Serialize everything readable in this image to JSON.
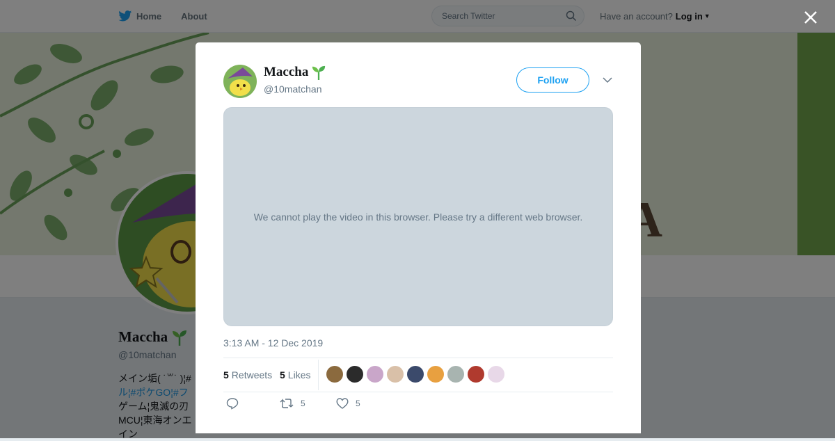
{
  "nav": {
    "home_label": "Home",
    "about_label": "About",
    "search_placeholder": "Search Twitter",
    "account_prompt": "Have an account?",
    "login_label": "Log in"
  },
  "profile": {
    "name": "Maccha",
    "handle": "@10matchan",
    "banner_letter": "A",
    "bio_lines": [
      "メイン垢( ˙꒳​˙ )¦#",
      "ル¦#ポケGO¦#フ",
      "ゲーム¦鬼滅の刃",
      "MCU¦東海オンエ",
      "イン"
    ]
  },
  "tweet": {
    "name": "Maccha",
    "handle": "@10matchan",
    "follow_label": "Follow",
    "video_message": "We cannot play the video in this browser. Please try a different web browser.",
    "timestamp": "3:13 AM - 12 Dec 2019",
    "retweets_count": "5",
    "retweets_label": "Retweets",
    "likes_count": "5",
    "likes_label": "Likes",
    "reply_count": "",
    "retweet_action_count": "5",
    "like_action_count": "5",
    "liker_colors": [
      "#8b6a3e",
      "#2b2b2b",
      "#c9a6c9",
      "#d9c0a8",
      "#3b4a6b",
      "#e8a040",
      "#a8b4b0",
      "#b03a2e",
      "#e8d8e8"
    ]
  },
  "colors": {
    "accent": "#1da1f2",
    "overlay": "rgba(0,0,0,0.5)",
    "video_bg": "#ccd6dd"
  }
}
